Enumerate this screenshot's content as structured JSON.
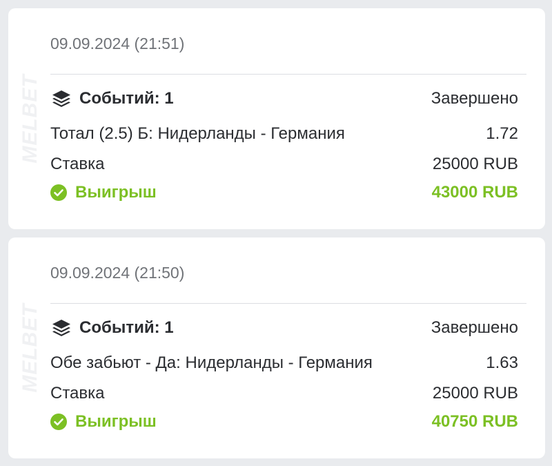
{
  "colors": {
    "background": "#e9ebee",
    "card": "#ffffff",
    "text": "#2b2d31",
    "muted": "#707378",
    "win": "#7cc024"
  },
  "bets": [
    {
      "datetime": "09.09.2024 (21:51)",
      "watermark": "MELBET",
      "events_label": "Событий: 1",
      "events_icon": "layers-icon",
      "status": "Завершено",
      "market": "Тотал (2.5) Б: Нидерланды - Германия",
      "odds": "1.72",
      "stake_label": "Ставка",
      "stake_value": "25000 RUB",
      "result_icon": "check-circle-icon",
      "result_label": "Выигрыш",
      "result_value": "43000 RUB"
    },
    {
      "datetime": "09.09.2024 (21:50)",
      "watermark": "MELBET",
      "events_label": "Событий: 1",
      "events_icon": "layers-icon",
      "status": "Завершено",
      "market": "Обе забьют - Да: Нидерланды - Германия",
      "odds": "1.63",
      "stake_label": "Ставка",
      "stake_value": "25000 RUB",
      "result_icon": "check-circle-icon",
      "result_label": "Выигрыш",
      "result_value": "40750 RUB"
    }
  ]
}
